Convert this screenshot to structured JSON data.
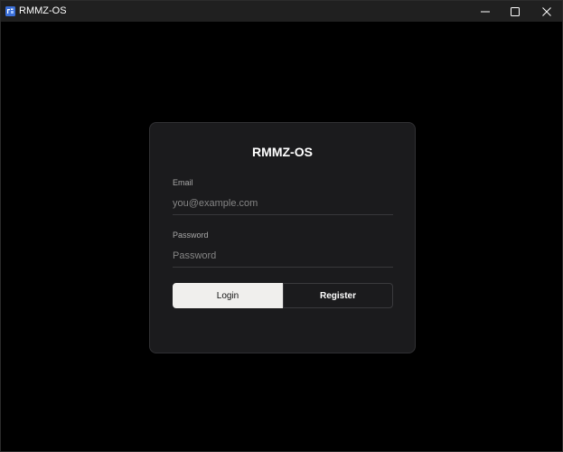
{
  "window": {
    "title": "RMMZ-OS",
    "icon": "app-logo-icon",
    "controls": {
      "minimize": "minimize-icon",
      "maximize": "maximize-icon",
      "close": "close-icon"
    }
  },
  "login_card": {
    "title": "RMMZ-OS",
    "email": {
      "label": "Email",
      "placeholder": "you@example.com",
      "value": ""
    },
    "password": {
      "label": "Password",
      "placeholder": "Password",
      "value": ""
    },
    "login_label": "Login",
    "register_label": "Register"
  },
  "colors": {
    "background": "#000000",
    "titlebar": "#202020",
    "card": "#1b1b1d",
    "card_border": "#303033",
    "primary_button": "#f0efed",
    "label_text": "#a8a8a8",
    "placeholder_text": "#858585"
  }
}
